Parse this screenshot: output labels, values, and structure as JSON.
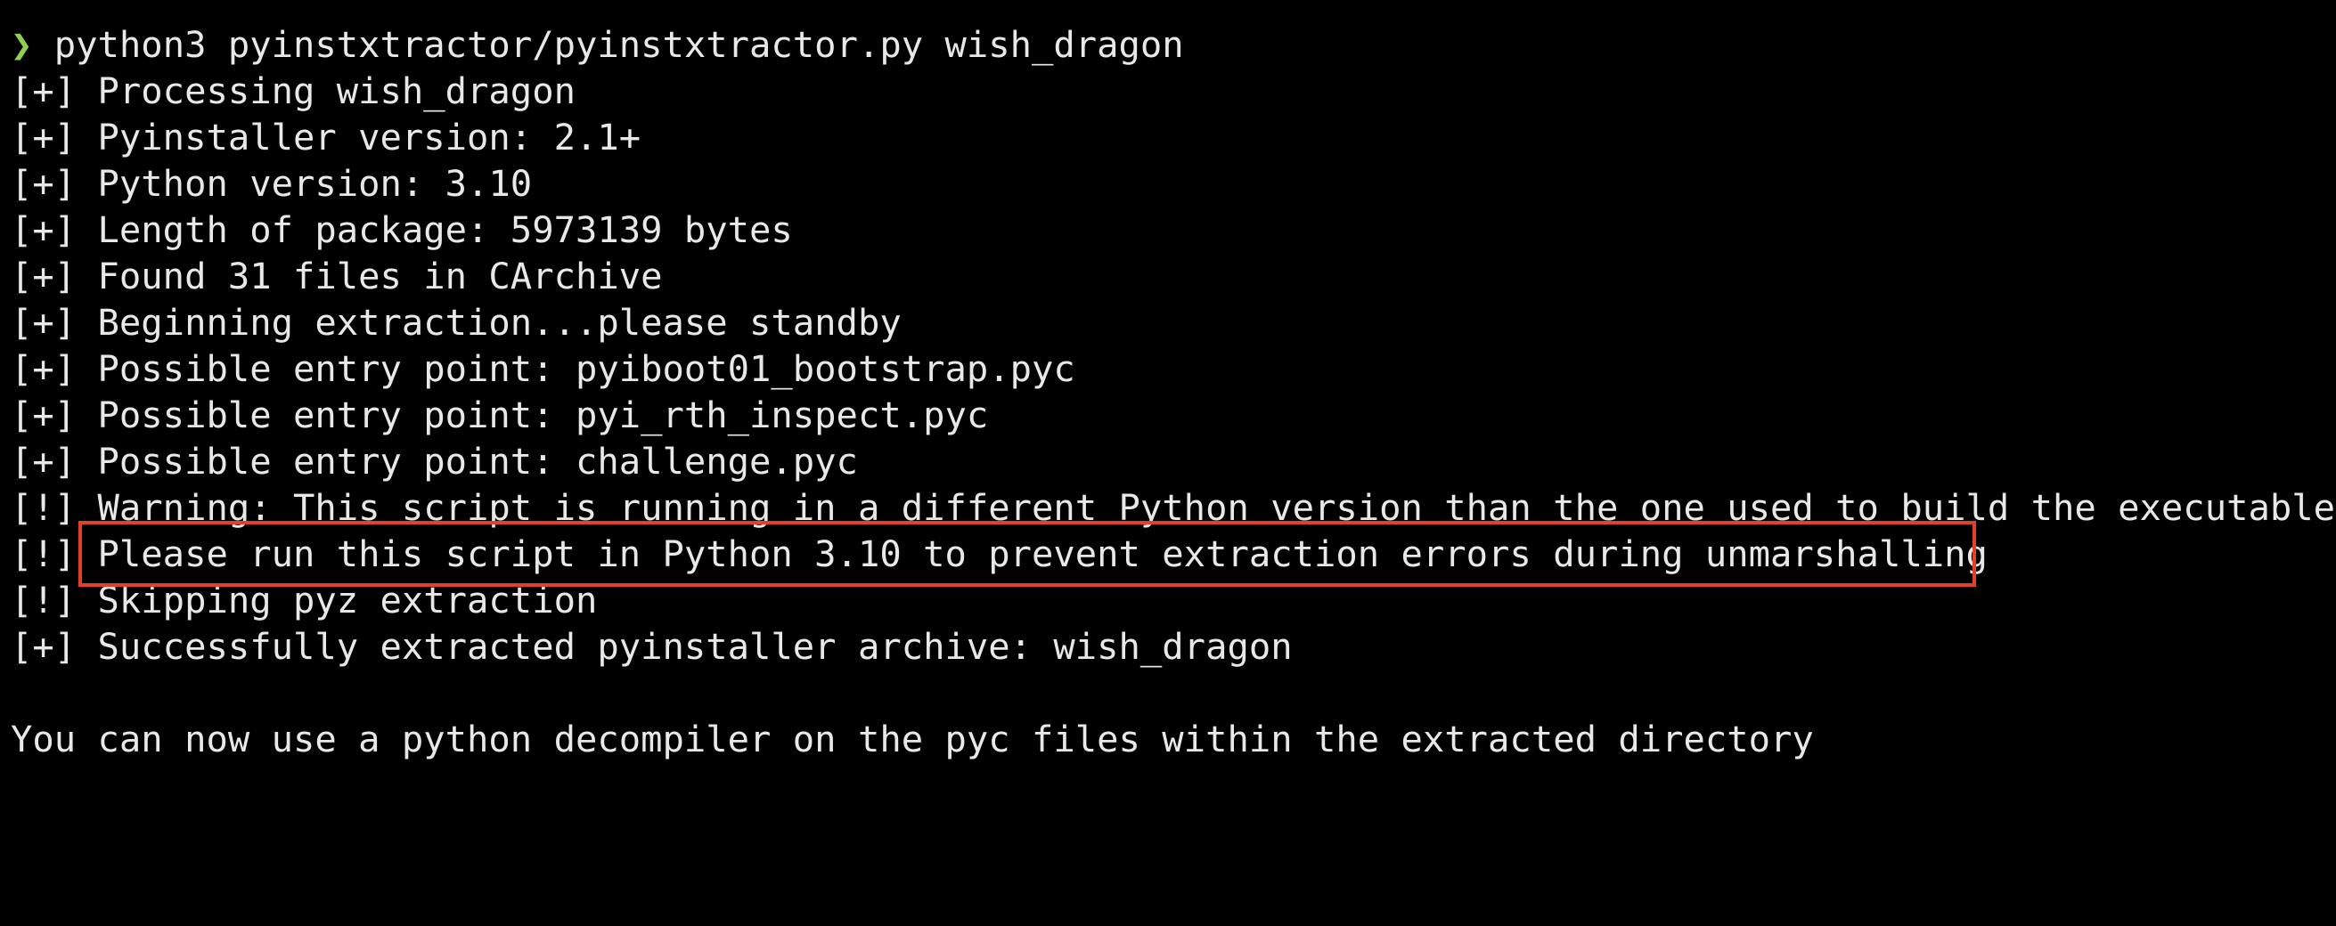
{
  "terminal": {
    "prompt_symbol": "❯",
    "command": " python3 pyinstxtractor/pyinstxtractor.py wish_dragon",
    "output_lines": [
      "[+] Processing wish_dragon",
      "[+] Pyinstaller version: 2.1+",
      "[+] Python version: 3.10",
      "[+] Length of package: 5973139 bytes",
      "[+] Found 31 files in CArchive",
      "[+] Beginning extraction...please standby",
      "[+] Possible entry point: pyiboot01_bootstrap.pyc",
      "[+] Possible entry point: pyi_rth_inspect.pyc",
      "[+] Possible entry point: challenge.pyc",
      "[!] Warning: This script is running in a different Python version than the one used to build the executable.",
      "[!] Please run this script in Python 3.10 to prevent extraction errors during unmarshalling",
      "[!] Skipping pyz extraction",
      "[+] Successfully extracted pyinstaller archive: wish_dragon",
      "",
      "You can now use a python decompiler on the pyc files within the extracted directory"
    ]
  },
  "colors": {
    "background": "#000000",
    "text": "#e8e8e8",
    "prompt": "#8fd14f",
    "highlight": "#e2402b"
  }
}
